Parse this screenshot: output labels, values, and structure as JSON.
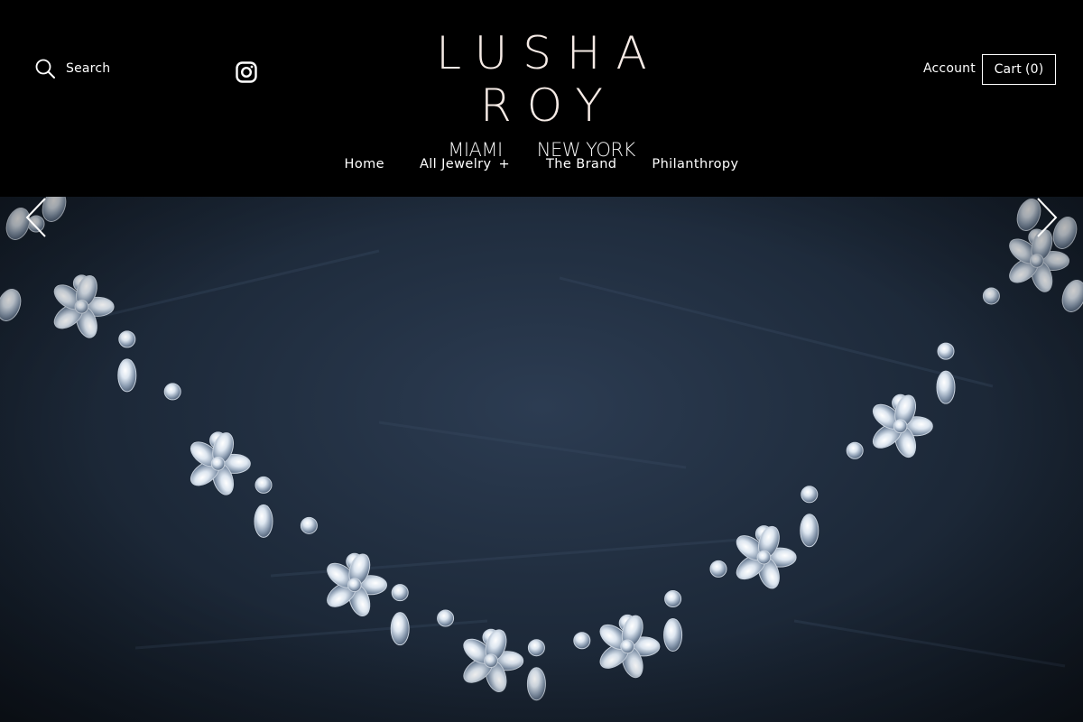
{
  "header": {
    "search_label": "Search",
    "logo_text": "LUSHA ROY",
    "logo_cities": [
      "MIAMI",
      "NEW YORK"
    ],
    "account_label": "Account",
    "cart_label": "Cart",
    "cart_count": "(0)"
  },
  "nav": {
    "items": [
      {
        "label": "Home"
      },
      {
        "label": "All Jewelry",
        "expand": "+"
      },
      {
        "label": "The Brand"
      },
      {
        "label": "Philanthropy"
      }
    ]
  },
  "hero": {
    "image_description": "diamond-necklace-on-slate",
    "prev_icon": "chevron-left-icon",
    "next_icon": "chevron-right-icon"
  },
  "colors": {
    "header_bg": "#000000",
    "header_text": "#ffffff",
    "logo": "#f6ebe6",
    "hero_bg": "#1f2c3d"
  },
  "icons": {
    "search": "search-icon",
    "social": "instagram-icon"
  }
}
